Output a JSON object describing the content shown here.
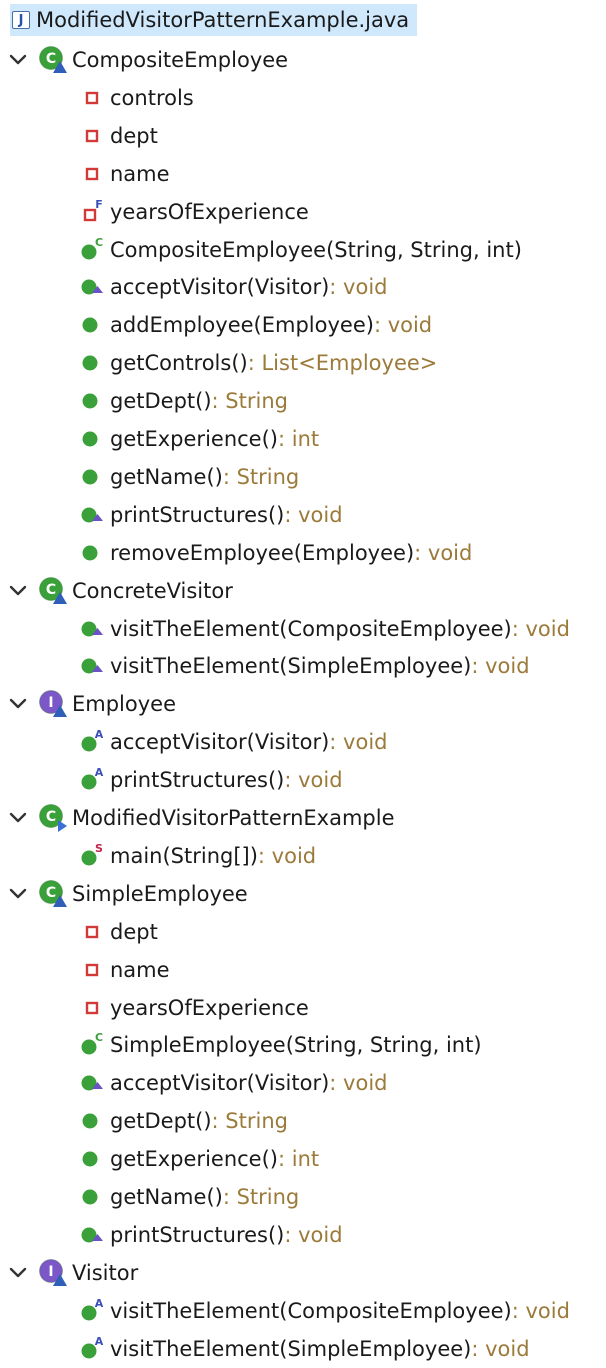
{
  "file": {
    "name": "ModifiedVisitorPatternExample.java",
    "icon": "java-file-icon"
  },
  "colors": {
    "selection": "#cfe8fb",
    "class_icon": "#3aa03a",
    "interface_icon": "#7b57c8",
    "method_public": "#3aa03a",
    "field_private": "#d23a3a",
    "return_type": "#9b7a3a"
  },
  "types": [
    {
      "name": "CompositeEmployee",
      "kind": "class",
      "icon": "class-icon",
      "members": [
        {
          "name": "controls",
          "ret": "",
          "icon": "private-field-icon"
        },
        {
          "name": "dept",
          "ret": "",
          "icon": "private-field-icon"
        },
        {
          "name": "name",
          "ret": "",
          "icon": "private-field-icon"
        },
        {
          "name": "yearsOfExperience",
          "ret": "",
          "icon": "private-final-field-icon"
        },
        {
          "name": "CompositeEmployee(String, String, int)",
          "ret": "",
          "icon": "constructor-icon"
        },
        {
          "name": "acceptVisitor(Visitor)",
          "ret": " : void",
          "icon": "override-method-icon"
        },
        {
          "name": "addEmployee(Employee)",
          "ret": " : void",
          "icon": "public-method-icon"
        },
        {
          "name": "getControls()",
          "ret": " : List<Employee>",
          "icon": "public-method-icon"
        },
        {
          "name": "getDept()",
          "ret": " : String",
          "icon": "public-method-icon"
        },
        {
          "name": "getExperience()",
          "ret": " : int",
          "icon": "public-method-icon"
        },
        {
          "name": "getName()",
          "ret": " : String",
          "icon": "public-method-icon"
        },
        {
          "name": "printStructures()",
          "ret": " : void",
          "icon": "override-method-icon"
        },
        {
          "name": "removeEmployee(Employee)",
          "ret": " : void",
          "icon": "public-method-icon"
        }
      ]
    },
    {
      "name": "ConcreteVisitor",
      "kind": "class",
      "icon": "class-icon",
      "members": [
        {
          "name": "visitTheElement(CompositeEmployee)",
          "ret": " : void",
          "icon": "override-method-icon"
        },
        {
          "name": "visitTheElement(SimpleEmployee)",
          "ret": " : void",
          "icon": "override-method-icon"
        }
      ]
    },
    {
      "name": "Employee",
      "kind": "interface",
      "icon": "interface-icon",
      "members": [
        {
          "name": "acceptVisitor(Visitor)",
          "ret": " : void",
          "icon": "abstract-method-icon"
        },
        {
          "name": "printStructures()",
          "ret": " : void",
          "icon": "abstract-method-icon"
        }
      ]
    },
    {
      "name": "ModifiedVisitorPatternExample",
      "kind": "class",
      "icon": "runnable-class-icon",
      "members": [
        {
          "name": "main(String[])",
          "ret": " : void",
          "icon": "static-method-icon"
        }
      ]
    },
    {
      "name": "SimpleEmployee",
      "kind": "class",
      "icon": "class-icon",
      "members": [
        {
          "name": "dept",
          "ret": "",
          "icon": "private-field-icon"
        },
        {
          "name": "name",
          "ret": "",
          "icon": "private-field-icon"
        },
        {
          "name": "yearsOfExperience",
          "ret": "",
          "icon": "private-field-icon"
        },
        {
          "name": "SimpleEmployee(String, String, int)",
          "ret": "",
          "icon": "constructor-icon"
        },
        {
          "name": "acceptVisitor(Visitor)",
          "ret": " : void",
          "icon": "override-method-icon"
        },
        {
          "name": "getDept()",
          "ret": " : String",
          "icon": "public-method-icon"
        },
        {
          "name": "getExperience()",
          "ret": " : int",
          "icon": "public-method-icon"
        },
        {
          "name": "getName()",
          "ret": " : String",
          "icon": "public-method-icon"
        },
        {
          "name": "printStructures()",
          "ret": " : void",
          "icon": "override-method-icon"
        }
      ]
    },
    {
      "name": "Visitor",
      "kind": "interface",
      "icon": "interface-icon",
      "members": [
        {
          "name": "visitTheElement(CompositeEmployee)",
          "ret": " : void",
          "icon": "abstract-method-icon"
        },
        {
          "name": "visitTheElement(SimpleEmployee)",
          "ret": " : void",
          "icon": "abstract-method-icon"
        }
      ]
    }
  ]
}
